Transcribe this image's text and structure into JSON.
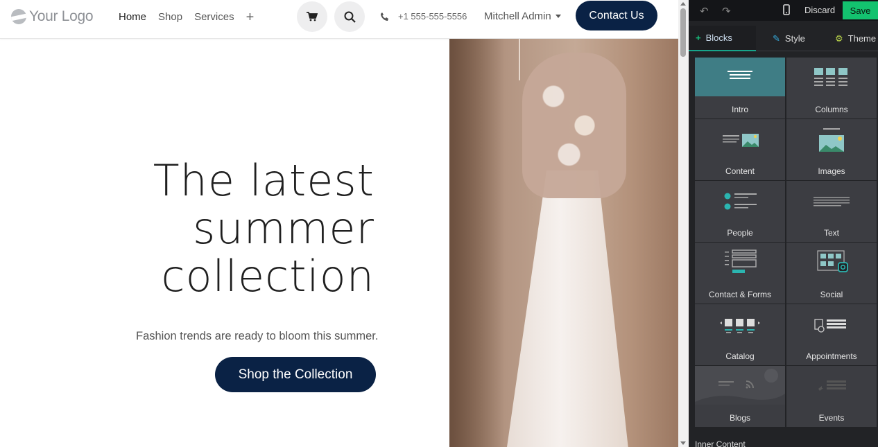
{
  "site": {
    "logo_text": "Your Logo",
    "nav": [
      {
        "label": "Home",
        "active": true
      },
      {
        "label": "Shop",
        "active": false
      },
      {
        "label": "Services",
        "active": false
      }
    ],
    "add_page_glyph": "+",
    "phone": "+1 555-555-5556",
    "user": "Mitchell Admin",
    "contact_button": "Contact Us",
    "hero": {
      "title_lines": [
        "The latest",
        "summer",
        "collection"
      ],
      "subtitle": "Fashion trends are ready to bloom this summer.",
      "button": "Shop the Collection"
    },
    "colors": {
      "primary": "#0a2245"
    }
  },
  "editor": {
    "toolbar": {
      "undo_icon": "undo-icon",
      "redo_icon": "redo-icon",
      "device_icon": "mobile-icon",
      "discard": "Discard",
      "save": "Save"
    },
    "tabs": [
      {
        "label": "Blocks",
        "icon": "plus-icon",
        "active": true
      },
      {
        "label": "Style",
        "icon": "pencil-icon",
        "active": false
      },
      {
        "label": "Theme",
        "icon": "gear-icon",
        "active": false
      }
    ],
    "blocks": [
      {
        "label": "Intro"
      },
      {
        "label": "Columns"
      },
      {
        "label": "Content"
      },
      {
        "label": "Images"
      },
      {
        "label": "People"
      },
      {
        "label": "Text"
      },
      {
        "label": "Contact & Forms"
      },
      {
        "label": "Social"
      },
      {
        "label": "Catalog"
      },
      {
        "label": "Appointments"
      },
      {
        "label": "Blogs"
      },
      {
        "label": "Events"
      }
    ],
    "section_label": "Inner Content",
    "colors": {
      "accent": "#17a58b",
      "save": "#13c26f"
    }
  }
}
